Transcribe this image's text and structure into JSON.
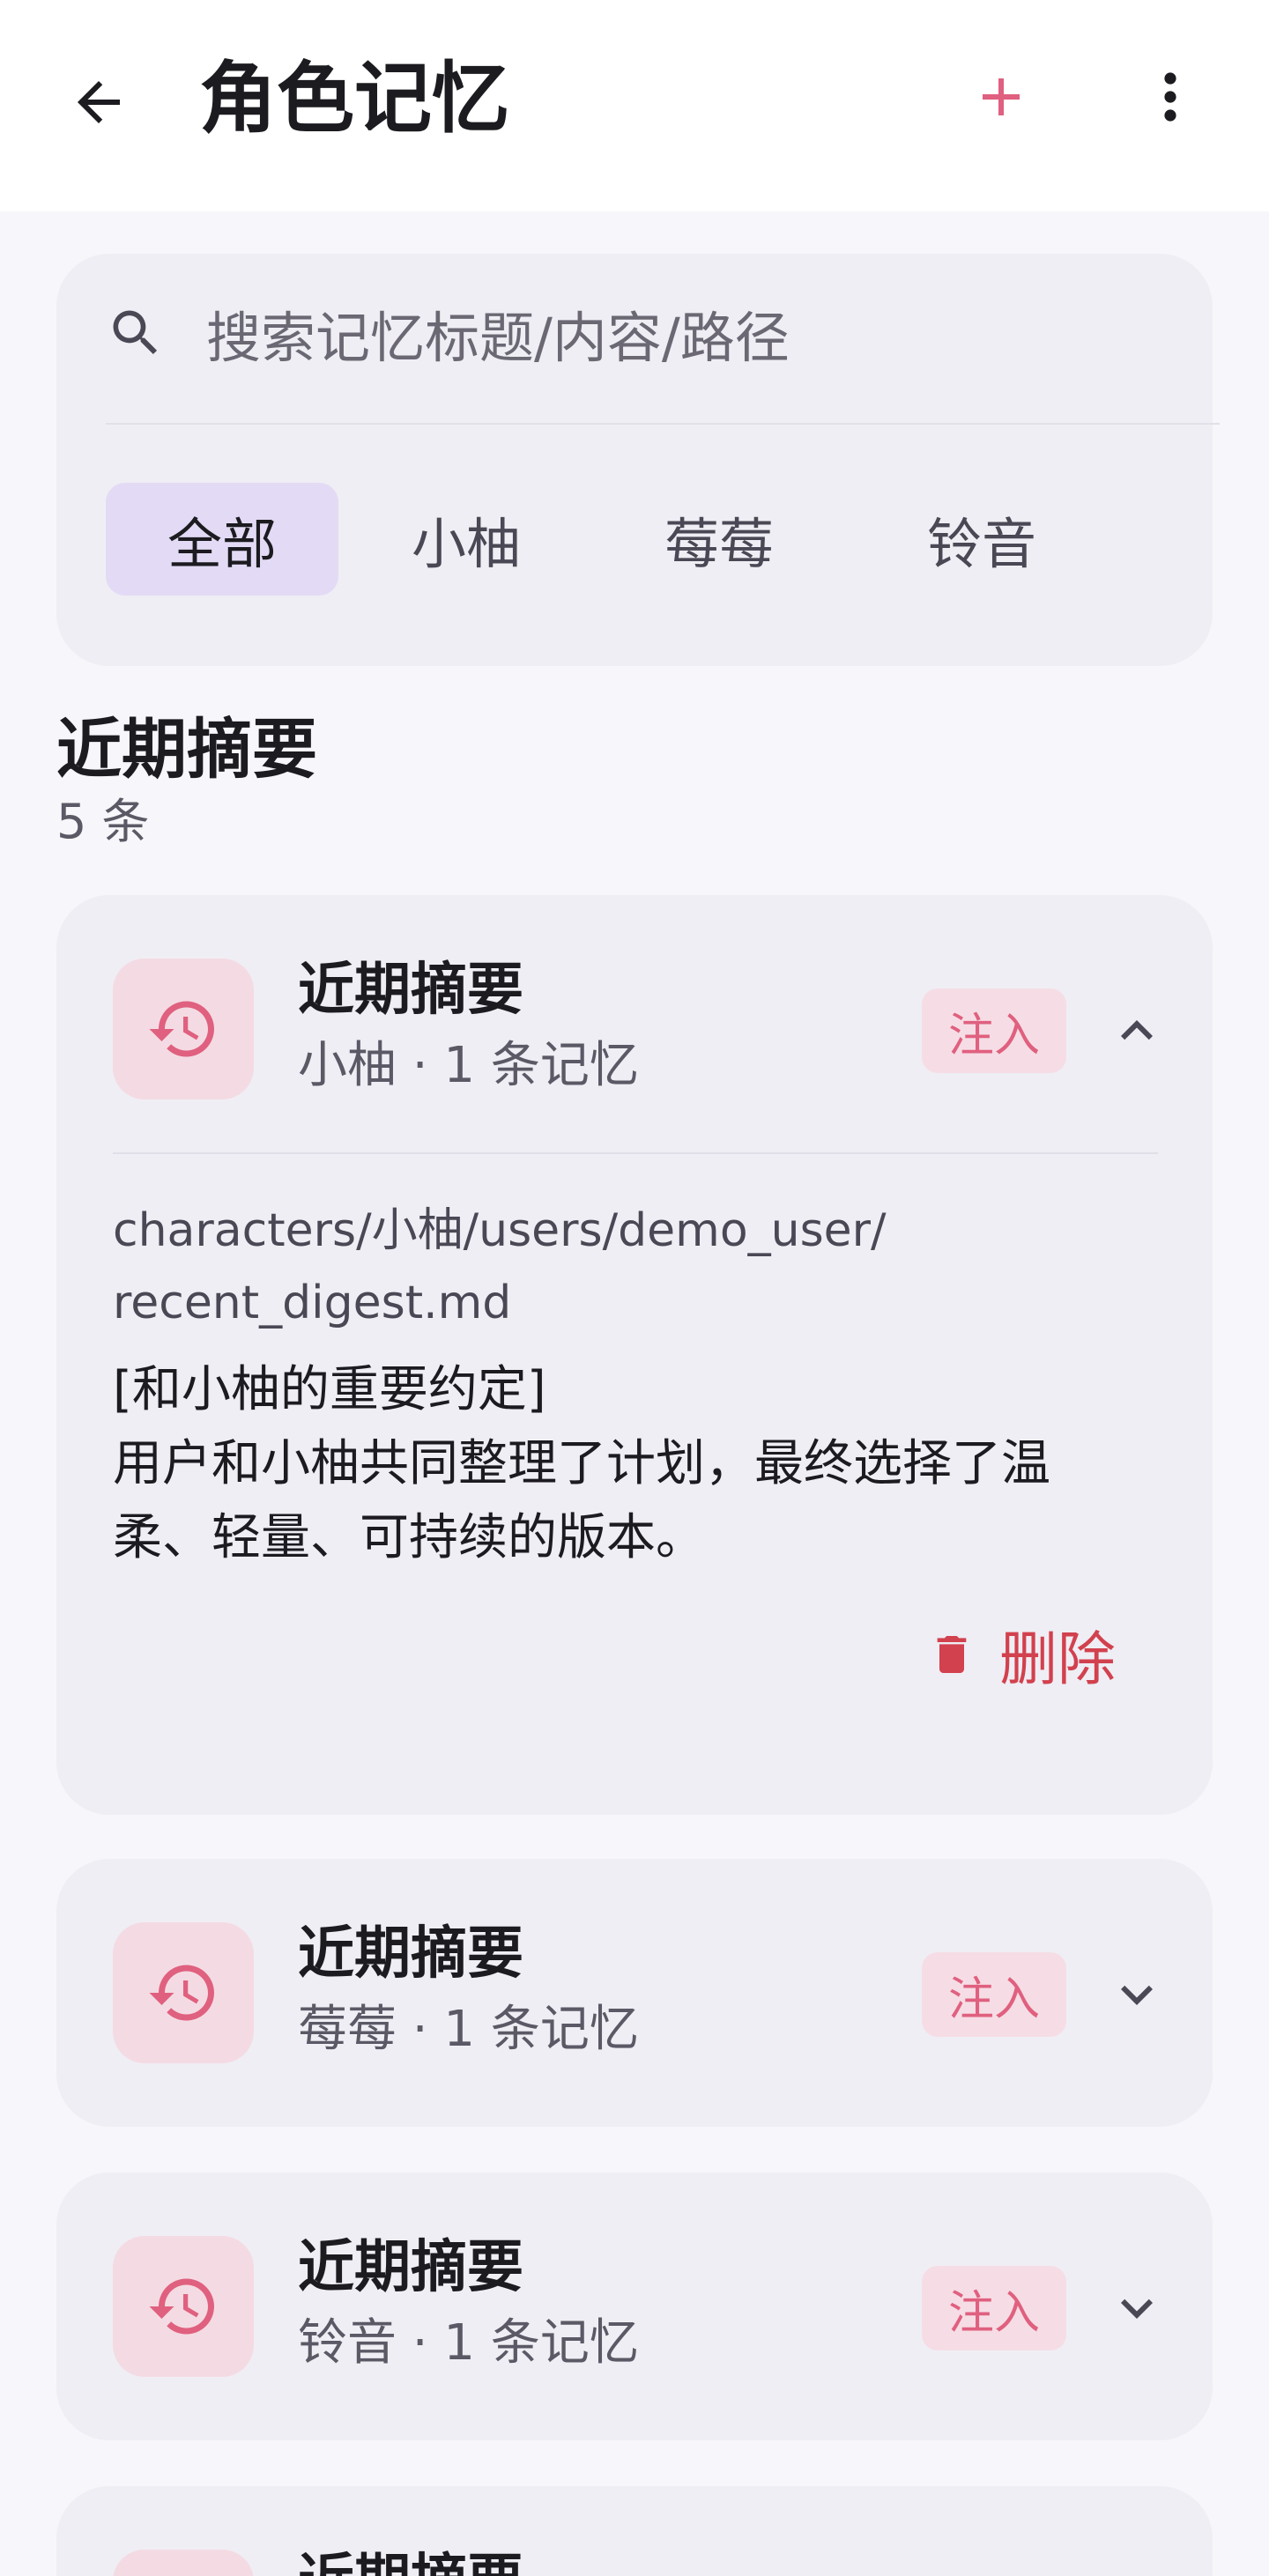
{
  "appbar": {
    "title": "角色记忆"
  },
  "search": {
    "placeholder": "搜索记忆标题/内容/路径"
  },
  "filters": [
    {
      "label": "全部",
      "selected": true
    },
    {
      "label": "小柚",
      "selected": false
    },
    {
      "label": "莓莓",
      "selected": false
    },
    {
      "label": "铃音",
      "selected": false
    }
  ],
  "section": {
    "title": "近期摘要",
    "count": "5 条"
  },
  "cards": [
    {
      "title": "近期摘要",
      "subtitle": "小柚 · 1 条记忆",
      "badge": "注入",
      "expanded": true,
      "path_line1": "characters/小柚/users/demo_user/",
      "path_line2": "recent_digest.md",
      "content_line1": "[和小柚的重要约定]",
      "content_line2": "用户和小柚共同整理了计划，最终选择了温",
      "content_line3": "柔、轻量、可持续的版本。",
      "delete_label": "删除"
    },
    {
      "title": "近期摘要",
      "subtitle": "莓莓 · 1 条记忆",
      "badge": "注入",
      "expanded": false
    },
    {
      "title": "近期摘要",
      "subtitle": "铃音 · 1 条记忆",
      "badge": "注入",
      "expanded": false
    },
    {
      "title": "近期摘要"
    }
  ],
  "colors": {
    "accent_pink": "#e0607f",
    "delete_red": "#d2414e",
    "chip_selected": "#e3dbf5",
    "card_bg": "#efeef4",
    "page_bg": "#f7f6fa"
  }
}
